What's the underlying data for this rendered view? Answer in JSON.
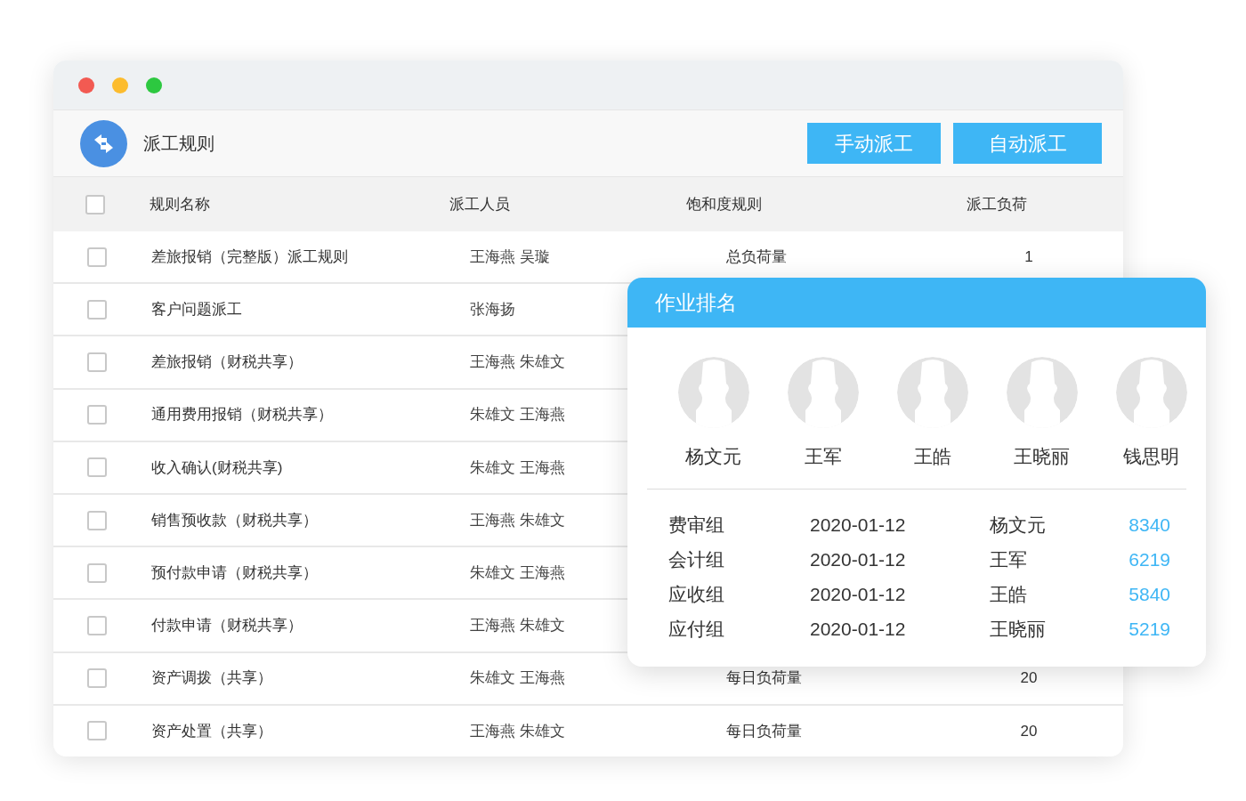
{
  "window": {
    "title": "派工规则"
  },
  "buttons": [
    "手动派工",
    "自动派工"
  ],
  "table": {
    "select_all": {
      "checked": false
    },
    "columns": [
      "规则名称",
      "派工人员",
      "饱和度规则",
      "派工负荷"
    ],
    "rows": [
      {
        "checked": false,
        "name": "差旅报销（完整版）派工规则",
        "staff": "王海燕 吴璇",
        "saturation": "总负荷量",
        "load": "1"
      },
      {
        "checked": false,
        "name": "客户问题派工",
        "staff": "张海扬"
      },
      {
        "checked": false,
        "name": "差旅报销（财税共享）",
        "staff": "王海燕 朱雄文"
      },
      {
        "checked": false,
        "name": "通用费用报销（财税共享）",
        "staff": "朱雄文 王海燕"
      },
      {
        "checked": false,
        "name": "收入确认(财税共享)",
        "staff": "朱雄文 王海燕"
      },
      {
        "checked": false,
        "name": "销售预收款（财税共享）",
        "staff": "王海燕 朱雄文"
      },
      {
        "checked": false,
        "name": "预付款申请（财税共享）",
        "staff": "朱雄文 王海燕"
      },
      {
        "checked": false,
        "name": "付款申请（财税共享）",
        "staff": "王海燕 朱雄文"
      },
      {
        "checked": false,
        "name": "资产调拨（共享）",
        "staff": "朱雄文 王海燕",
        "saturation": "每日负荷量",
        "load": "20"
      },
      {
        "checked": false,
        "name": "资产处置（共享）",
        "staff": "王海燕 朱雄文",
        "saturation": "每日负荷量",
        "load": "20"
      }
    ]
  },
  "ranking_panel": {
    "title": "作业排名",
    "people": [
      "杨文元",
      "王军",
      "王皓",
      "王晓丽",
      "钱思明"
    ],
    "rows": [
      {
        "group": "费审组",
        "date": "2020-01-12",
        "name": "杨文元",
        "score": "8340"
      },
      {
        "group": "会计组",
        "date": "2020-01-12",
        "name": "王军",
        "score": "6219"
      },
      {
        "group": "应收组",
        "date": "2020-01-12",
        "name": "王皓",
        "score": "5840"
      },
      {
        "group": "应付组",
        "date": "2020-01-12",
        "name": "王晓丽",
        "score": "5219"
      }
    ]
  }
}
